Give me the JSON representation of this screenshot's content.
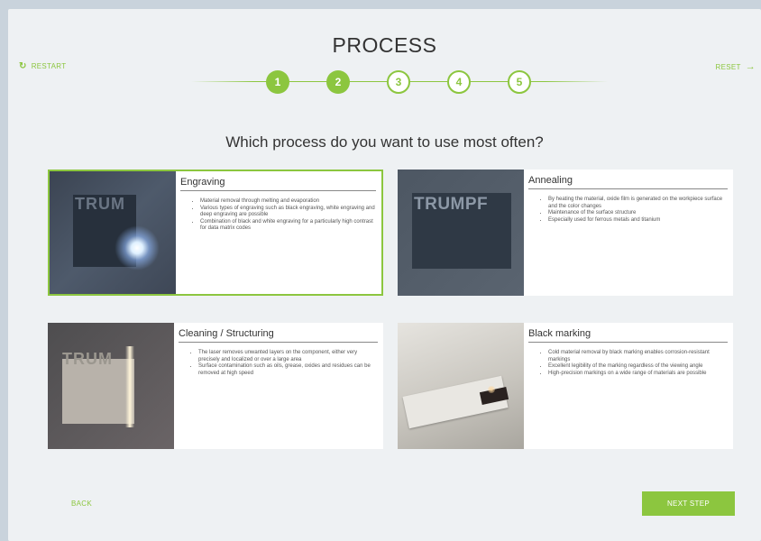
{
  "header": {
    "restart_label": "RESTART",
    "reset_label": "RESET",
    "title": "PROCESS"
  },
  "stepper": {
    "steps": [
      {
        "label": "1",
        "state": "done"
      },
      {
        "label": "2",
        "state": "done"
      },
      {
        "label": "3",
        "state": "todo"
      },
      {
        "label": "4",
        "state": "todo"
      },
      {
        "label": "5",
        "state": "todo"
      }
    ]
  },
  "question": "Which process do you want to use most often?",
  "options": [
    {
      "title": "Engraving",
      "selected": true,
      "bullets": [
        "Material removal through melting and evaporation",
        "Various types of engraving such as black engraving, white engraving and deep engraving are possible",
        "Combination of black and white engraving for a particularly high contrast for data matrix codes"
      ]
    },
    {
      "title": "Annealing",
      "selected": false,
      "bullets": [
        "By heating the material, oxide film is generated on the workpiece surface and the color changes",
        "Maintenance of the surface structure",
        "Especially used for ferrous metals and titanium"
      ]
    },
    {
      "title": "Cleaning / Structuring",
      "selected": false,
      "bullets": [
        "The laser removes unwanted layers on the component, either very precisely and localized or over a large area",
        "Surface contamination such as oils, grease, oxides and residues can be removed at high speed"
      ]
    },
    {
      "title": "Black marking",
      "selected": false,
      "bullets": [
        "Cold material removal by black marking enables corrosion-resistant markings",
        "Excellent legibility of the marking regardless of the viewing angle",
        "High-precision markings on a wide range of materials are possible"
      ]
    }
  ],
  "thumb_logos": {
    "engraving": "TRUM",
    "annealing": "TRUMPF",
    "cleaning": "TRUM"
  },
  "footer": {
    "back_label": "BACK",
    "next_label": "NEXT STEP"
  },
  "colors": {
    "accent": "#8cc63f",
    "background": "#eef1f3"
  }
}
